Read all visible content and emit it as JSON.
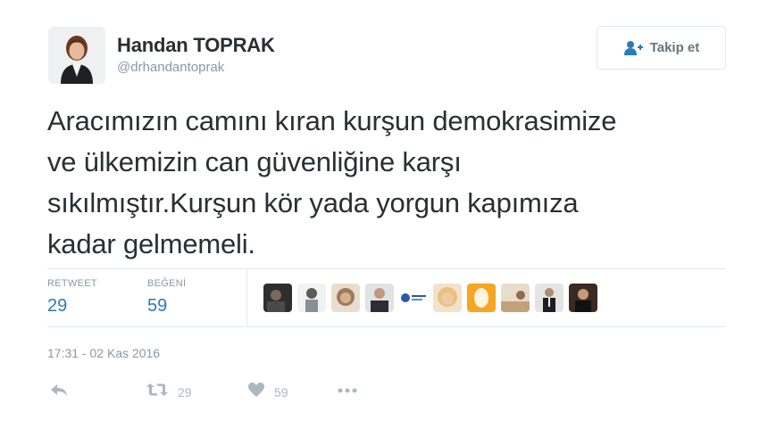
{
  "user": {
    "name": "Handan TOPRAK",
    "handle": "@drhandantoprak"
  },
  "follow_button": {
    "label": "Takip et",
    "icon": "follow-person-plus-icon"
  },
  "tweet": {
    "lines": [
      "Aracımızın camını kıran kurşun demokrasimize",
      "ve ülkemizin can güvenliğine karşı",
      "sıkılmıştır.Kurşun kör yada yorgun kapımıza",
      "kadar gelmemeli."
    ],
    "timestamp": "17:31 - 02 Kas 2016"
  },
  "stats": {
    "retweets_label": "RETWEET",
    "retweets": "29",
    "likes_label": "BEĞENİ",
    "likes": "59"
  },
  "actions": {
    "reply_icon": "reply-icon",
    "retweet_icon": "retweet-icon",
    "retweet_count": "29",
    "like_icon": "heart-icon",
    "like_count": "59",
    "more_icon": "more-dots-icon"
  },
  "likers_count_shown": 10,
  "colors": {
    "text": "#292f33",
    "muted": "#8899a6",
    "stat_value": "#2b7bb9",
    "action_gray": "#aab8c2",
    "border": "#e1e8ed"
  }
}
